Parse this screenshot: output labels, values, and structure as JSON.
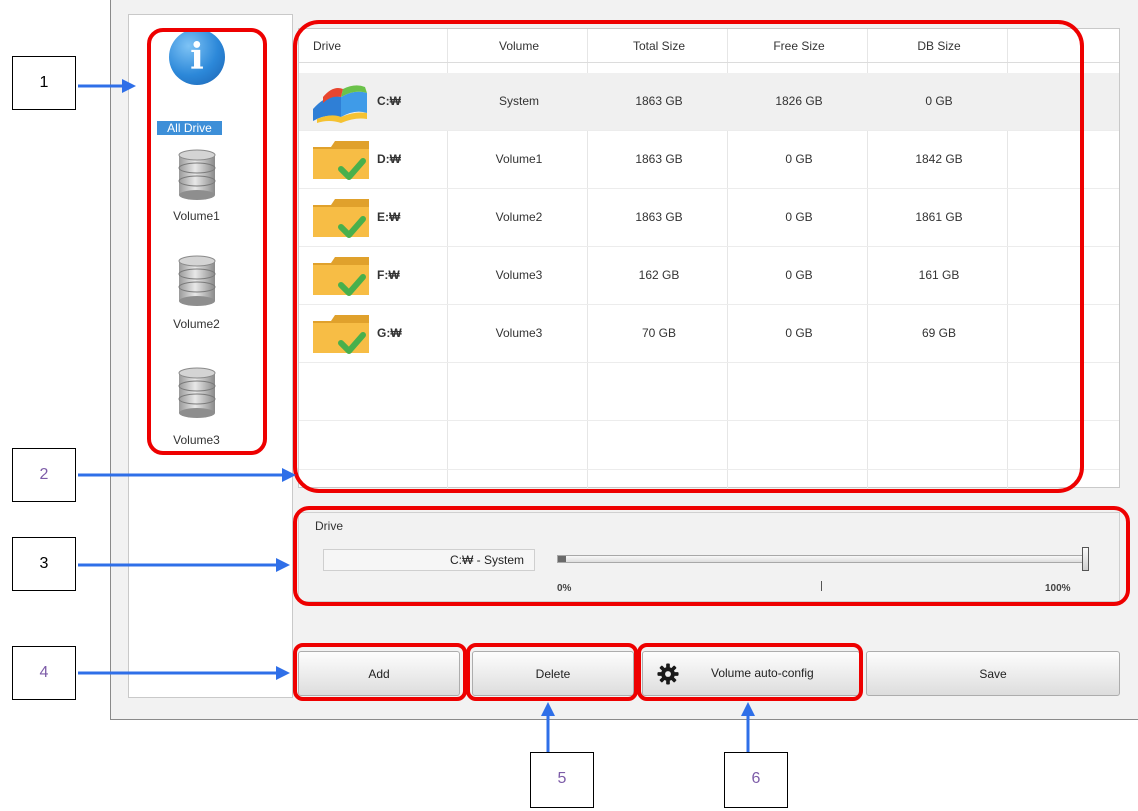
{
  "sidebar": {
    "items": [
      {
        "label": "All Drive",
        "icon": "info-icon",
        "selected": true
      },
      {
        "label": "Volume1",
        "icon": "database-icon"
      },
      {
        "label": "Volume2",
        "icon": "database-icon"
      },
      {
        "label": "Volume3",
        "icon": "database-icon"
      }
    ]
  },
  "table": {
    "headers": {
      "drive": "Drive",
      "volume": "Volume",
      "total": "Total Size",
      "free": "Free Size",
      "db": "DB Size"
    },
    "rows": [
      {
        "icon": "windows-drive-icon",
        "drive": "C:₩",
        "volume": "System",
        "total": "1863 GB",
        "free": "1826 GB",
        "db": "0 GB"
      },
      {
        "icon": "folder-check-icon",
        "drive": "D:₩",
        "volume": "Volume1",
        "total": "1863 GB",
        "free": "0 GB",
        "db": "1842 GB"
      },
      {
        "icon": "folder-check-icon",
        "drive": "E:₩",
        "volume": "Volume2",
        "total": "1863 GB",
        "free": "0 GB",
        "db": "1861 GB"
      },
      {
        "icon": "folder-check-icon",
        "drive": "F:₩",
        "volume": "Volume3",
        "total": "162 GB",
        "free": "0 GB",
        "db": "161 GB"
      },
      {
        "icon": "folder-check-icon",
        "drive": "G:₩",
        "volume": "Volume3",
        "total": "70 GB",
        "free": "0 GB",
        "db": "69 GB"
      }
    ]
  },
  "drive_panel": {
    "title": "Drive",
    "selected_drive": "C:₩ - System",
    "slider": {
      "min_label": "0%",
      "max_label": "100%",
      "value": 1.0
    }
  },
  "buttons": {
    "add": "Add",
    "delete": "Delete",
    "auto_config": "Volume auto-config",
    "save": "Save"
  },
  "callouts": [
    "1",
    "2",
    "3",
    "4",
    "5",
    "6"
  ],
  "colors": {
    "highlight": "#ee0000",
    "arrow": "#2f6fe8",
    "selection": "#3d8fd8",
    "folder": "#f5b93f",
    "check": "#4caf50"
  }
}
